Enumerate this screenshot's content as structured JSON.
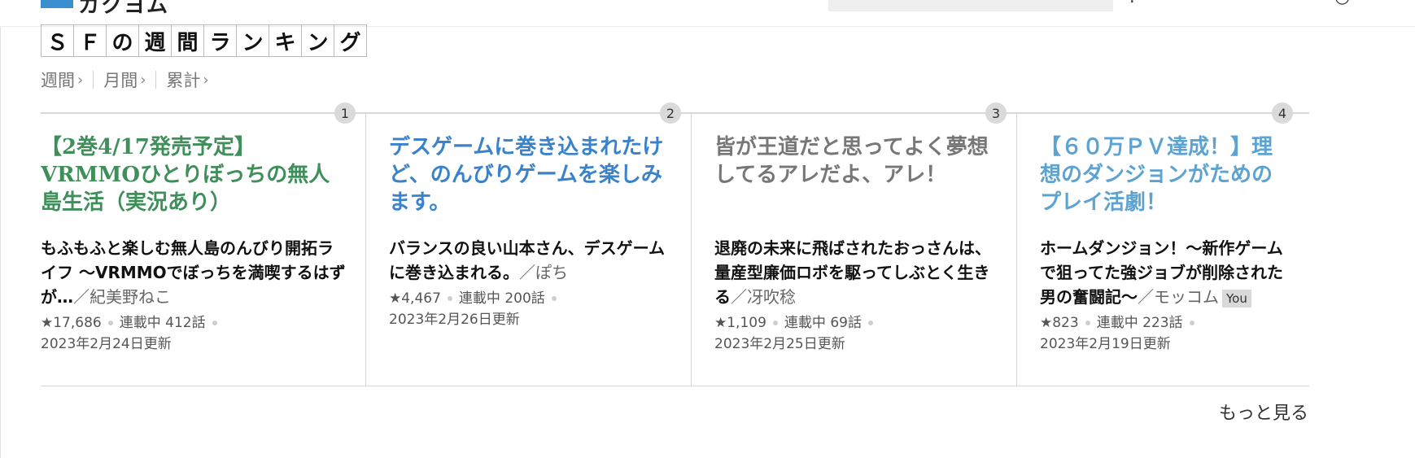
{
  "heading": {
    "chars": [
      "Ｓ",
      "Ｆ",
      "の",
      "週",
      "間",
      "ラ",
      "ン",
      "キ",
      "ン",
      "グ"
    ]
  },
  "tabs": [
    {
      "label": "週間"
    },
    {
      "label": "月間"
    },
    {
      "label": "累計"
    }
  ],
  "rankings": [
    {
      "rank": "1",
      "title": "【2巻4/17発売予定】VRMMOひとりぼっちの無人島生活（実況あり）",
      "title_color": "#3e8f5a",
      "description": "もふもふと楽しむ無人島のんびり開拓ライフ ～VRMMOでぼっちを満喫するはずが…",
      "author": "／紀美野ねこ",
      "stars": "★17,686",
      "status": "連載中 412話",
      "updated": "2023年2月24日更新"
    },
    {
      "rank": "2",
      "title": "デスゲームに巻き込まれたけど、のんびりゲームを楽しみます。",
      "title_color": "#3a82c9",
      "description": "バランスの良い山本さん、デスゲームに巻き込まれる。",
      "author": "／ぽち",
      "stars": "★4,467",
      "status": "連載中 200話",
      "updated": "2023年2月26日更新"
    },
    {
      "rank": "3",
      "title": "皆が王道だと思ってよく夢想してるアレだよ、アレ！",
      "title_color": "#777777",
      "description": "退廃の未来に飛ばされたおっさんは、量産型廉価ロボを駆ってしぶとく生きる",
      "author": "／冴吹稔",
      "stars": "★1,109",
      "status": "連載中 69話",
      "updated": "2023年2月25日更新"
    },
    {
      "rank": "4",
      "title": "【６０万ＰＶ達成！】理想のダンジョンがためのプレイ活劇！",
      "title_color": "#5ca3d2",
      "description": "ホームダンジョン！～新作ゲームで狙ってた強ジョブが削除された男の奮闘記～",
      "author": "／モッコム",
      "you_badge": "You",
      "stars": "★823",
      "status": "連載中 223話",
      "updated": "2023年2月19日更新"
    }
  ],
  "more_label": "もっと見る"
}
